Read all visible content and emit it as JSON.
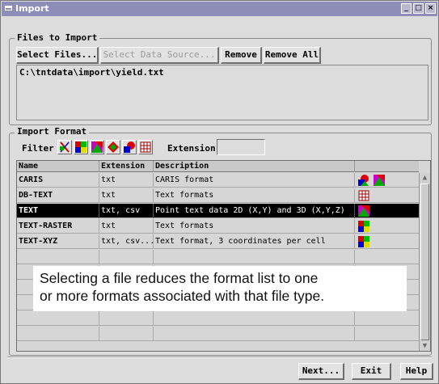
{
  "window": {
    "title": "Import",
    "buttons": {
      "minimize": "_",
      "maximize": "□",
      "close": "×"
    }
  },
  "files_group": {
    "label": "Files to Import",
    "select_files": "Select Files...",
    "select_data_source": "Select Data Source...",
    "remove": "Remove",
    "remove_all": "Remove All",
    "path": "C:\\tntdata\\import\\yield.txt"
  },
  "format_group": {
    "label": "Import Format",
    "filter_label": "Filter",
    "extension_label": "Extension",
    "extension_value": "",
    "filter_icons": [
      "all-types-icon",
      "raster-icon",
      "vector-icon",
      "shape-icon",
      "cad-icon",
      "database-icon"
    ]
  },
  "table": {
    "columns": [
      "Name",
      "Extension",
      "Description"
    ],
    "rows": [
      {
        "name": "CARIS",
        "extension": "txt",
        "description": "CARIS format",
        "icons": [
          "shape-icon",
          "vector-icon"
        ],
        "selected": false
      },
      {
        "name": "DB-TEXT",
        "extension": "txt",
        "description": "Text formats",
        "icons": [
          "database-icon"
        ],
        "selected": false
      },
      {
        "name": "TEXT",
        "extension": "txt, csv",
        "description": "Point text data 2D (X,Y) and 3D (X,Y,Z)",
        "icons": [
          "vector-icon"
        ],
        "selected": true
      },
      {
        "name": "TEXT-RASTER",
        "extension": "txt",
        "description": "Text formats",
        "icons": [
          "raster-icon"
        ],
        "selected": false
      },
      {
        "name": "TEXT-XYZ",
        "extension": "txt, csv...",
        "description": "Text format, 3 coordinates per cell",
        "icons": [
          "raster-icon"
        ],
        "selected": false
      }
    ]
  },
  "callout": {
    "line1": "Selecting a file reduces the format list to one",
    "line2": "or more formats associated with that file type."
  },
  "footer": {
    "next": "Next...",
    "exit": "Exit",
    "help": "Help"
  },
  "colors": {
    "titlebar": "#8d8db8",
    "selection": "#000000",
    "window_bg": "#dcdcdc"
  }
}
